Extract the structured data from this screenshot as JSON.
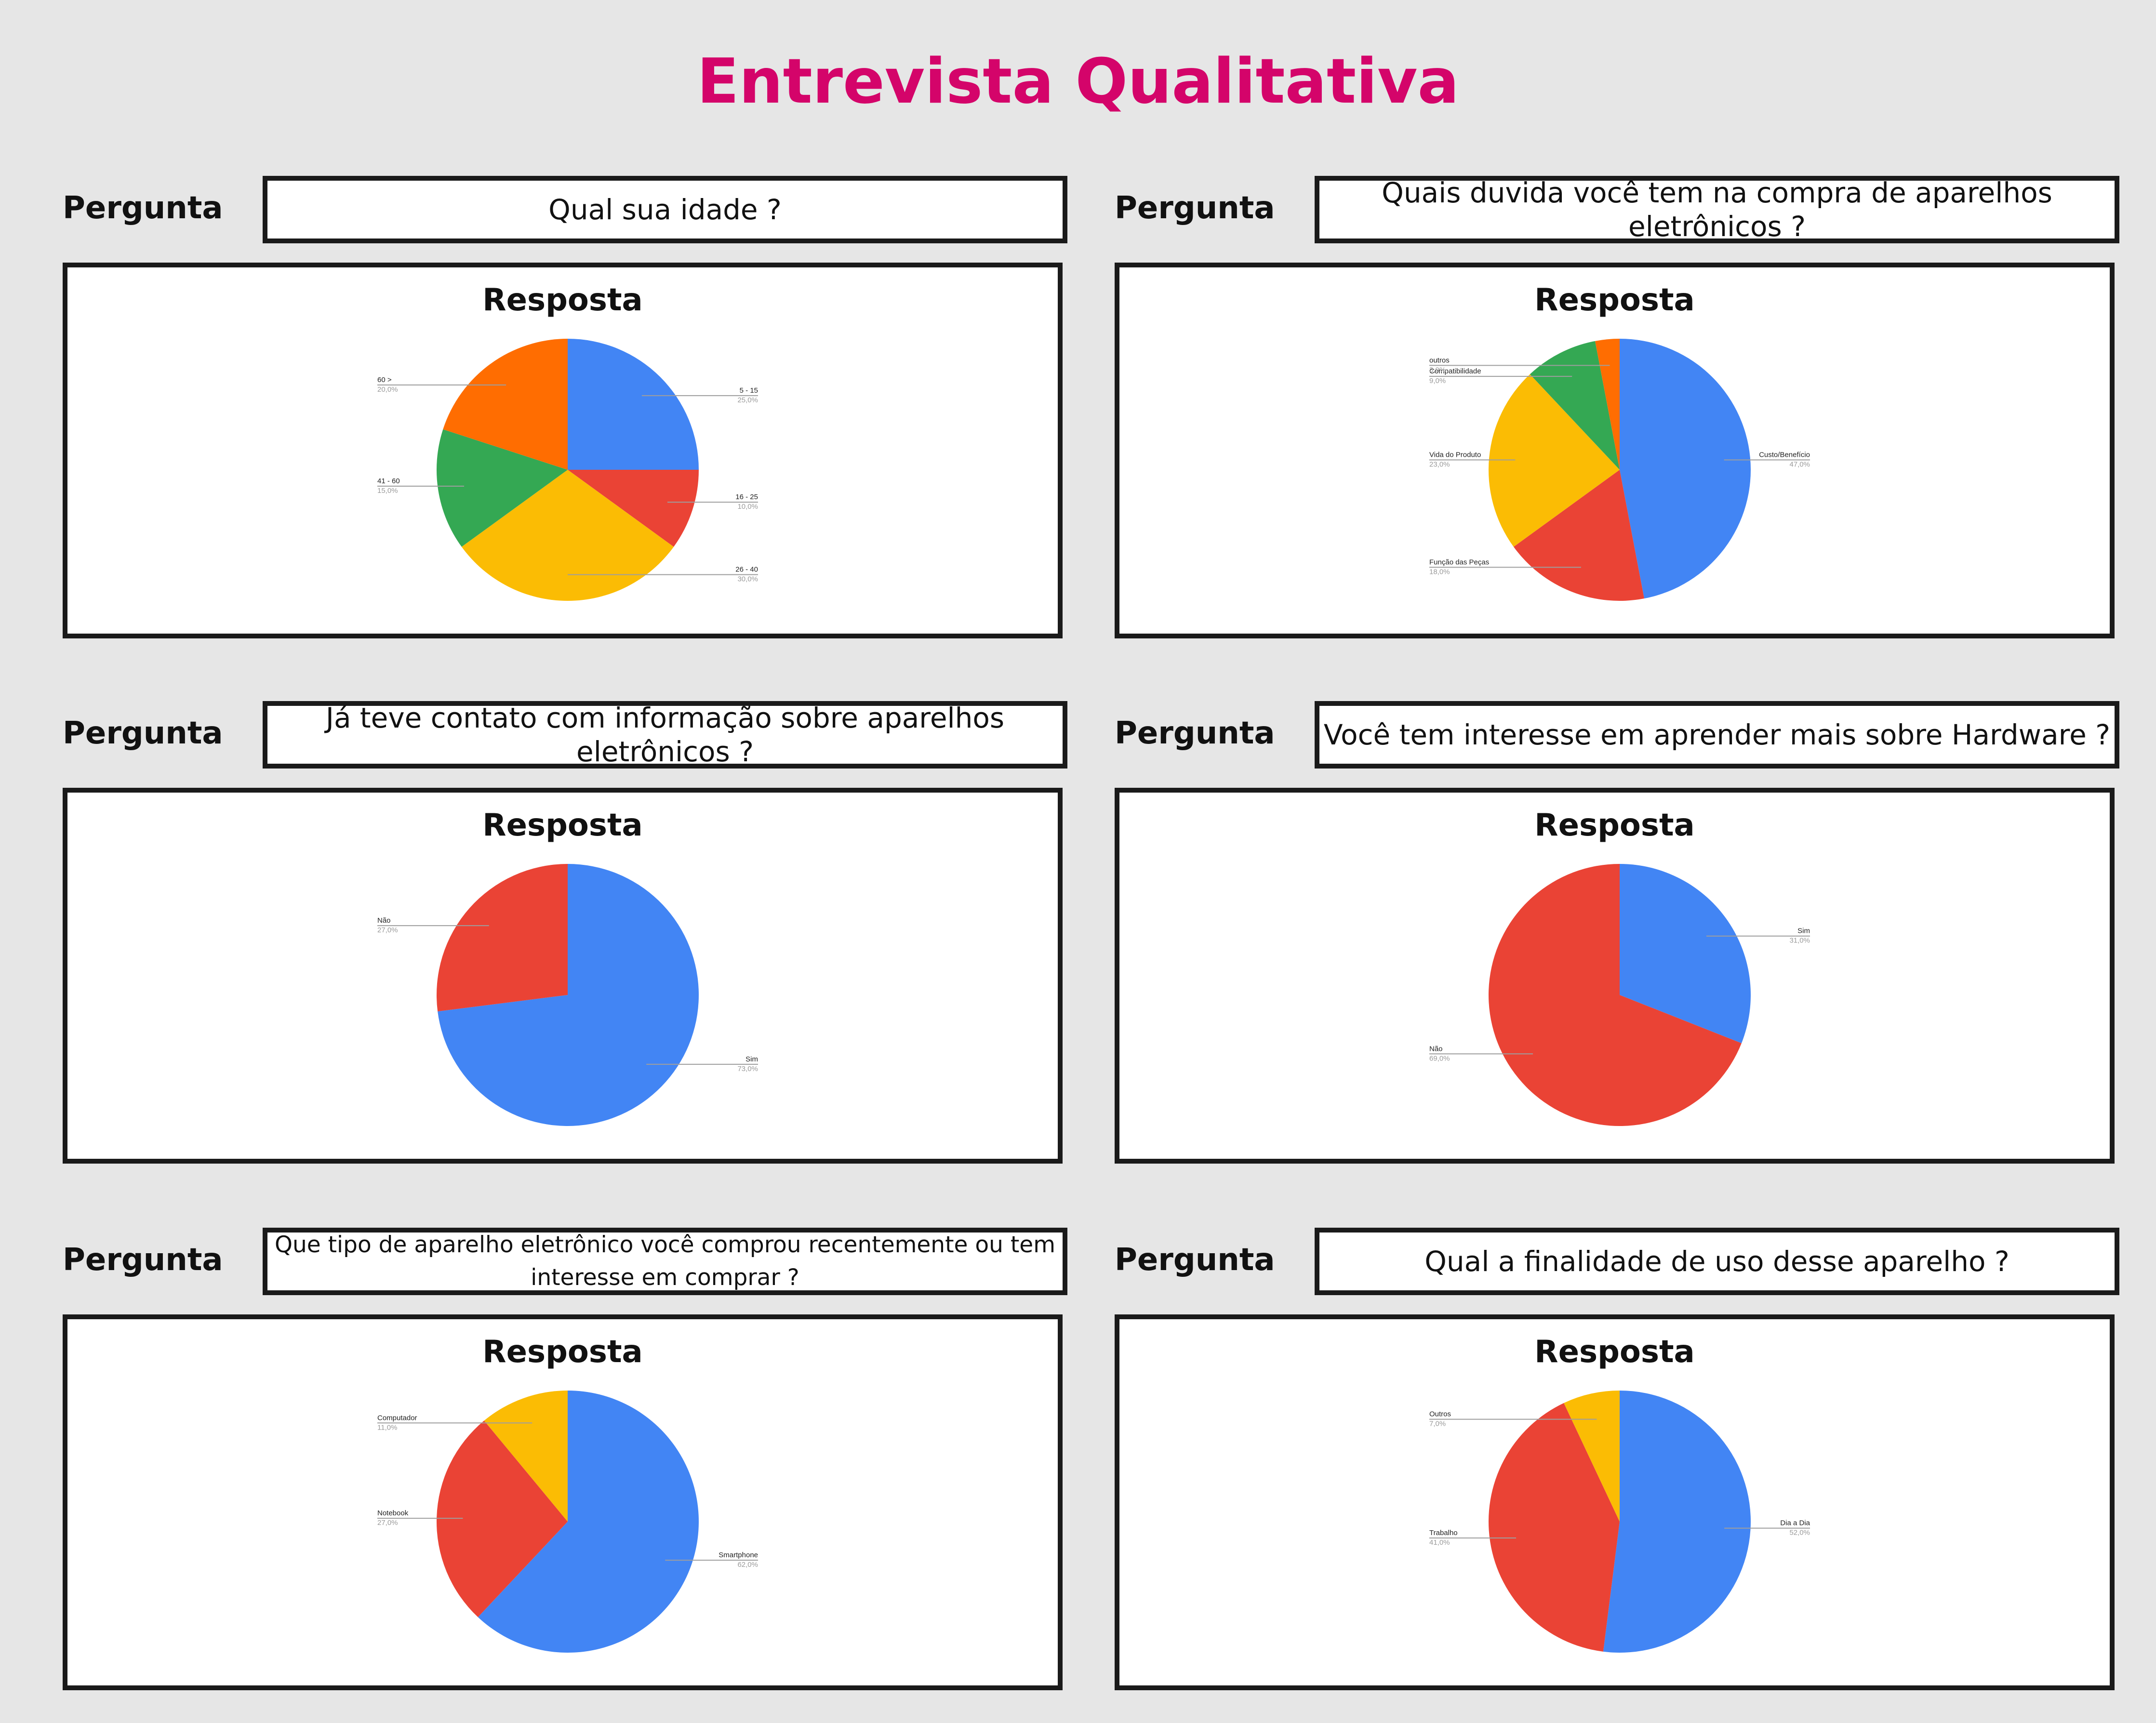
{
  "title": "Entrevista Qualitativa",
  "labels": {
    "pergunta": "Pergunta",
    "resposta": "Resposta"
  },
  "colors": {
    "blue": "#4285f4",
    "red": "#ea4335",
    "yellow": "#fbbc04",
    "green": "#34a853",
    "orange": "#ff6d01",
    "title": "#d4046a"
  },
  "questions": [
    "Qual sua idade ?",
    "Quais duvida você tem na compra de aparelhos eletrônicos ?",
    "Já teve contato com informação sobre aparelhos eletrônicos ?",
    "Você tem interesse em aprender mais sobre Hardware ?",
    "Que tipo de aparelho eletrônico você comprou recentemente ou tem interesse em comprar ?",
    "Qual a finalidade de uso desse aparelho ?"
  ],
  "chart_data": [
    {
      "type": "pie",
      "slices": [
        {
          "label": "5 - 15",
          "value": 25.0,
          "pct": "25,0%",
          "color": "#4285f4"
        },
        {
          "label": "16 - 25",
          "value": 10.0,
          "pct": "10,0%",
          "color": "#ea4335"
        },
        {
          "label": "26 - 40",
          "value": 30.0,
          "pct": "30,0%",
          "color": "#fbbc04"
        },
        {
          "label": "41 - 60",
          "value": 15.0,
          "pct": "15,0%",
          "color": "#34a853"
        },
        {
          "label": "60 >",
          "value": 20.0,
          "pct": "20,0%",
          "color": "#ff6d01"
        }
      ]
    },
    {
      "type": "pie",
      "slices": [
        {
          "label": "Custo/Benefício",
          "value": 47.0,
          "pct": "47,0%",
          "color": "#4285f4"
        },
        {
          "label": "Função das Peças",
          "value": 18.0,
          "pct": "18,0%",
          "color": "#ea4335"
        },
        {
          "label": "Vida do Produto",
          "value": 23.0,
          "pct": "23,0%",
          "color": "#fbbc04"
        },
        {
          "label": "Compatibilidade",
          "value": 9.0,
          "pct": "9,0%",
          "color": "#34a853"
        },
        {
          "label": "outros",
          "value": 3.0,
          "pct": "3,0%",
          "color": "#ff6d01"
        }
      ]
    },
    {
      "type": "pie",
      "slices": [
        {
          "label": "Sim",
          "value": 73.0,
          "pct": "73,0%",
          "color": "#4285f4"
        },
        {
          "label": "Não",
          "value": 27.0,
          "pct": "27,0%",
          "color": "#ea4335"
        }
      ]
    },
    {
      "type": "pie",
      "slices": [
        {
          "label": "Sim",
          "value": 31.0,
          "pct": "31,0%",
          "color": "#4285f4"
        },
        {
          "label": "Não",
          "value": 69.0,
          "pct": "69,0%",
          "color": "#ea4335"
        }
      ]
    },
    {
      "type": "pie",
      "slices": [
        {
          "label": "Smartphone",
          "value": 62.0,
          "pct": "62,0%",
          "color": "#4285f4"
        },
        {
          "label": "Notebook",
          "value": 27.0,
          "pct": "27,0%",
          "color": "#ea4335"
        },
        {
          "label": "Computador",
          "value": 11.0,
          "pct": "11,0%",
          "color": "#fbbc04"
        }
      ]
    },
    {
      "type": "pie",
      "slices": [
        {
          "label": "Dia a Dia",
          "value": 52.0,
          "pct": "52,0%",
          "color": "#4285f4"
        },
        {
          "label": "Trabalho",
          "value": 41.0,
          "pct": "41,0%",
          "color": "#ea4335"
        },
        {
          "label": "Outros",
          "value": 7.0,
          "pct": "7,0%",
          "color": "#fbbc04"
        }
      ]
    }
  ]
}
